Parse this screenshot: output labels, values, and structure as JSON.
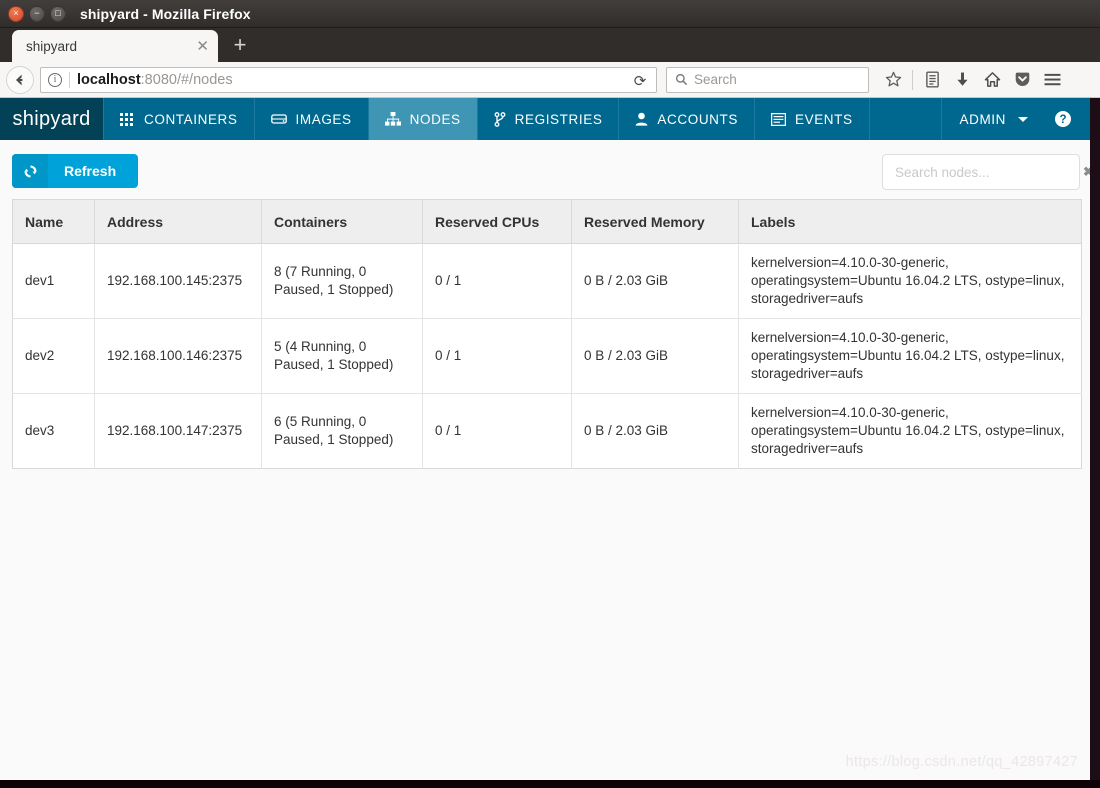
{
  "window": {
    "title": "shipyard - Mozilla Firefox",
    "close_glyph": "×",
    "minimize_glyph": "−",
    "maximize_glyph": "□"
  },
  "browser": {
    "tab": {
      "label": "shipyard",
      "close_glyph": "✕"
    },
    "new_tab_glyph": "+",
    "back_glyph": "←",
    "identity_glyph": "i",
    "url_host": "localhost",
    "url_rest": ":8080/#/nodes",
    "reload_glyph": "⟳",
    "search_placeholder": "Search",
    "toolbar_icons": [
      {
        "name": "bookmark-star-icon",
        "glyph": "☆"
      },
      {
        "name": "reader-list-icon",
        "glyph": "▤"
      },
      {
        "name": "downloads-icon",
        "glyph": "⬇"
      },
      {
        "name": "home-icon",
        "glyph": "⌂"
      },
      {
        "name": "pocket-icon",
        "glyph": "▽"
      },
      {
        "name": "hamburger-menu-icon",
        "glyph": "☰"
      }
    ]
  },
  "app": {
    "brand": "shipyard",
    "nav_items": [
      {
        "label": "CONTAINERS",
        "icon": "grid-icon",
        "active": false
      },
      {
        "label": "IMAGES",
        "icon": "disk-icon",
        "active": false
      },
      {
        "label": "NODES",
        "icon": "sitemap-icon",
        "active": true
      },
      {
        "label": "REGISTRIES",
        "icon": "branch-icon",
        "active": false
      },
      {
        "label": "ACCOUNTS",
        "icon": "user-icon",
        "active": false
      },
      {
        "label": "EVENTS",
        "icon": "list-icon",
        "active": false
      }
    ],
    "admin_label": "ADMIN",
    "help_glyph": "?",
    "colors": {
      "navbar": "#00688f",
      "brand_bg": "#024156",
      "active_tab": "#3f96b4",
      "primary_button": "#00a3d9"
    }
  },
  "toolbar": {
    "refresh_label": "Refresh",
    "refresh_icon": "refresh-icon",
    "refresh_glyph": "↻",
    "search_placeholder": "Search nodes...",
    "search_value": "",
    "clear_glyph": "✖"
  },
  "table": {
    "columns": [
      "Name",
      "Address",
      "Containers",
      "Reserved CPUs",
      "Reserved Memory",
      "Labels"
    ],
    "rows": [
      {
        "name": "dev1",
        "address": "192.168.100.145:2375",
        "containers": "8 (7 Running, 0 Paused, 1 Stopped)",
        "reserved_cpus": "0 / 1",
        "reserved_memory": "0 B / 2.03 GiB",
        "labels": "kernelversion=4.10.0-30-generic, operatingsystem=Ubuntu 16.04.2 LTS, ostype=linux, storagedriver=aufs"
      },
      {
        "name": "dev2",
        "address": "192.168.100.146:2375",
        "containers": "5 (4 Running, 0 Paused, 1 Stopped)",
        "reserved_cpus": "0 / 1",
        "reserved_memory": "0 B / 2.03 GiB",
        "labels": "kernelversion=4.10.0-30-generic, operatingsystem=Ubuntu 16.04.2 LTS, ostype=linux, storagedriver=aufs"
      },
      {
        "name": "dev3",
        "address": "192.168.100.147:2375",
        "containers": "6 (5 Running, 0 Paused, 1 Stopped)",
        "reserved_cpus": "0 / 1",
        "reserved_memory": "0 B / 2.03 GiB",
        "labels": "kernelversion=4.10.0-30-generic, operatingsystem=Ubuntu 16.04.2 LTS, ostype=linux, storagedriver=aufs"
      }
    ]
  },
  "watermark": "https://blog.csdn.net/qq_42897427"
}
